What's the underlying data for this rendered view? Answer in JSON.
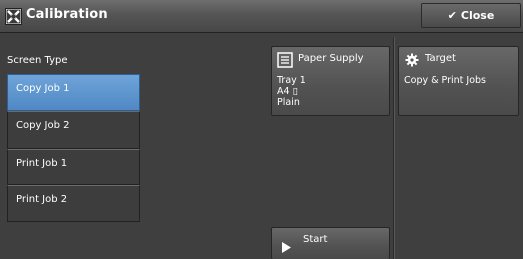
{
  "header": {
    "title": "Calibration",
    "close_label": "Close"
  },
  "screen_type": {
    "label": "Screen Type",
    "items": [
      {
        "label": "Copy Job 1",
        "selected": true
      },
      {
        "label": "Copy Job 2",
        "selected": false
      },
      {
        "label": "Print Job 1",
        "selected": false
      },
      {
        "label": "Print Job 2",
        "selected": false
      }
    ]
  },
  "paper_supply": {
    "label": "Paper Supply",
    "tray": "Tray 1",
    "size": "A4 ▯",
    "type": "Plain"
  },
  "target": {
    "label": "Target",
    "value": "Copy & Print Jobs"
  },
  "start": {
    "label": "Start"
  },
  "colors": {
    "background": "#3f3f3f",
    "selected": "#5b93cd",
    "tile": "#5a5a5a"
  }
}
